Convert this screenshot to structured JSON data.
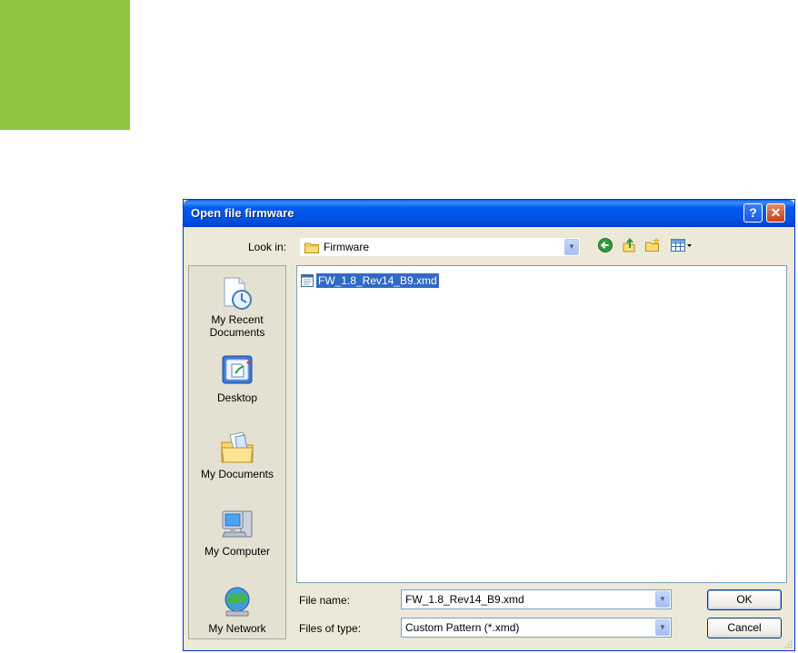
{
  "dialog": {
    "title": "Open file firmware",
    "help_glyph": "?",
    "close_glyph": "✕"
  },
  "lookin": {
    "label": "Look in:",
    "value": "Firmware"
  },
  "toolbar": {
    "icons": [
      "back-icon",
      "up-folder-icon",
      "new-folder-icon",
      "view-menu-icon"
    ]
  },
  "places": [
    {
      "label_line1": "My Recent",
      "label_line2": "Documents",
      "icon": "recent-documents-icon"
    },
    {
      "label_line1": "Desktop",
      "label_line2": "",
      "icon": "desktop-icon"
    },
    {
      "label_line1": "My Documents",
      "label_line2": "",
      "icon": "my-documents-icon"
    },
    {
      "label_line1": "My Computer",
      "label_line2": "",
      "icon": "my-computer-icon"
    },
    {
      "label_line1": "My Network",
      "label_line2": "",
      "icon": "my-network-icon"
    }
  ],
  "files": [
    {
      "name": "FW_1.8_Rev14_B9.xmd",
      "selected": true,
      "icon": "file-icon"
    }
  ],
  "filename": {
    "label": "File name:",
    "value": "FW_1.8_Rev14_B9.xmd"
  },
  "filetype": {
    "label": "Files of type:",
    "value": "Custom Pattern (*.xmd)"
  },
  "buttons": {
    "ok": "OK",
    "cancel": "Cancel"
  },
  "colors": {
    "accent_green": "#8dc63f",
    "titlebar_blue": "#0054e3",
    "selection_blue": "#316ac5"
  }
}
